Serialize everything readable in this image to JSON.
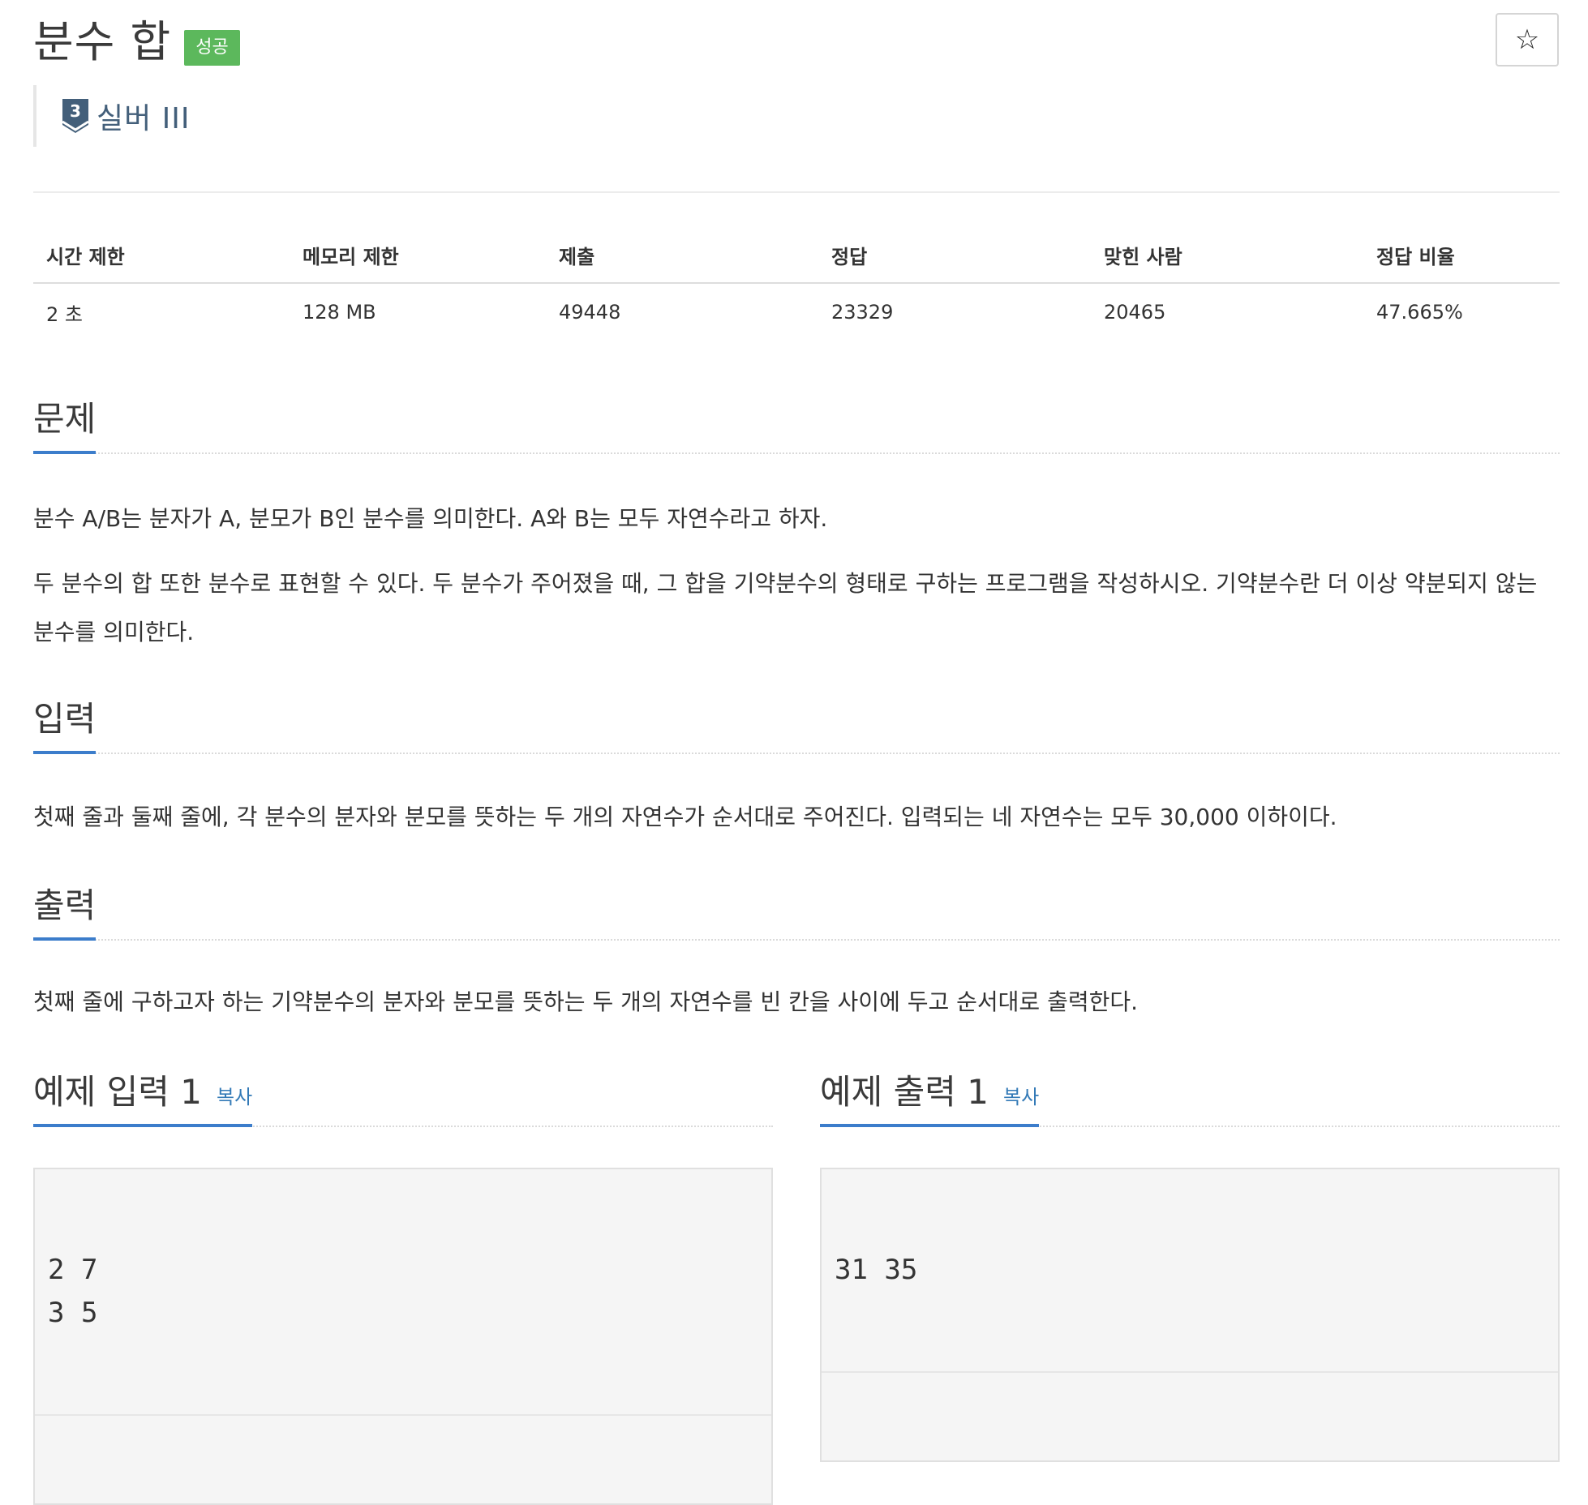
{
  "header": {
    "title": "분수 합",
    "badge": "성공",
    "star_icon": "☆",
    "tier": "실버 III",
    "tier_number": "3"
  },
  "info": {
    "headers": [
      "시간 제한",
      "메모리 제한",
      "제출",
      "정답",
      "맞힌 사람",
      "정답 비율"
    ],
    "values": [
      "2 초",
      "128 MB",
      "49448",
      "23329",
      "20465",
      "47.665%"
    ]
  },
  "problem": {
    "title": "문제",
    "paragraphs": [
      "분수 A/B는 분자가 A, 분모가 B인 분수를 의미한다. A와 B는 모두 자연수라고 하자.",
      "두 분수의 합 또한 분수로 표현할 수 있다. 두 분수가 주어졌을 때, 그 합을 기약분수의 형태로 구하는 프로그램을 작성하시오. 기약분수란 더 이상 약분되지 않는 분수를 의미한다."
    ]
  },
  "input": {
    "title": "입력",
    "text": "첫째 줄과 둘째 줄에, 각 분수의 분자와 분모를 뜻하는 두 개의 자연수가 순서대로 주어진다. 입력되는 네 자연수는 모두 30,000 이하이다."
  },
  "output": {
    "title": "출력",
    "text": "첫째 줄에 구하고자 하는 기약분수의 분자와 분모를 뜻하는 두 개의 자연수를 빈 칸을 사이에 두고 순서대로 출력한다."
  },
  "samples": {
    "input": {
      "title": "예제 입력 1",
      "copy": "복사",
      "content": "2 7\n3 5"
    },
    "output": {
      "title": "예제 출력 1",
      "copy": "복사",
      "content": "31 35"
    }
  },
  "colors": {
    "accent": "#3c7dcb",
    "success": "#5cb85c",
    "tier": "#435f7a"
  }
}
